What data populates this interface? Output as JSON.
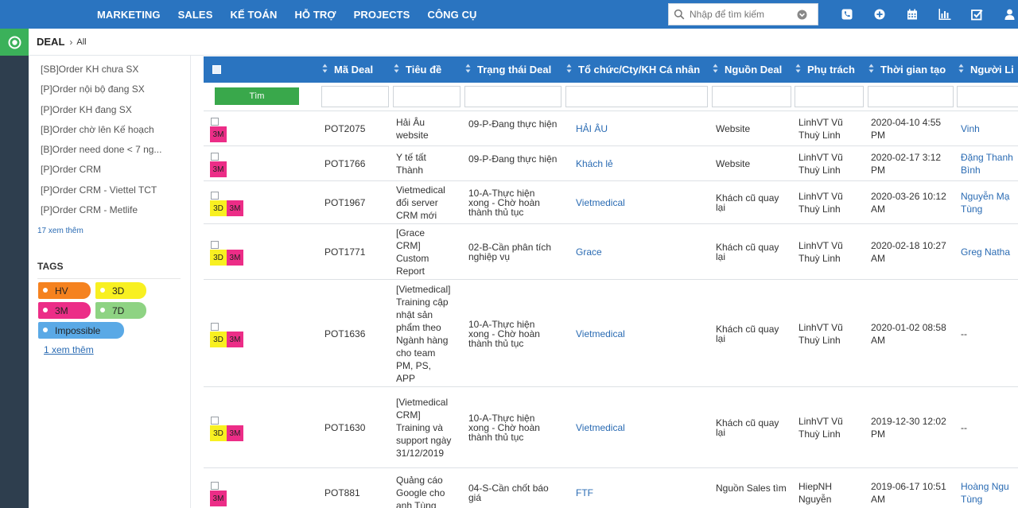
{
  "topnav": {
    "items": [
      "MARKETING",
      "SALES",
      "KẾ TOÁN",
      "HỖ TRỢ",
      "PROJECTS",
      "CÔNG CỤ"
    ]
  },
  "search": {
    "placeholder": "Nhập để tìm kiếm"
  },
  "toolbar": {
    "icons": [
      "phone-icon",
      "plus-circle-icon",
      "calendar-icon",
      "bar-chart-icon",
      "check-square-icon",
      "user-icon"
    ]
  },
  "breadcrumb": {
    "main": "DEAL",
    "sub": "All"
  },
  "filters": {
    "items": [
      "[SB]Order KH chưa SX",
      "[P]Order nội bộ đang SX",
      "[P]Order KH đang SX",
      "[B]Order chờ lên Kế hoạch",
      "[B]Order need done < 7 ng...",
      "[P]Order CRM",
      "[P]Order CRM - Viettel TCT",
      "[P]Order CRM - Metlife"
    ],
    "more": "17 xem thêm"
  },
  "tags": {
    "title": "TAGS",
    "items": [
      {
        "label": "HV",
        "color": "#f5821f"
      },
      {
        "label": "3D",
        "color": "#f8f021"
      },
      {
        "label": "3M",
        "color": "#ec2d87"
      },
      {
        "label": "7D",
        "color": "#8ed383"
      },
      {
        "label": "Impossible",
        "color": "#5aa9e6"
      }
    ],
    "more": "1  xem thêm"
  },
  "table": {
    "find_label": "Tìm",
    "headers": [
      "Mã Deal",
      "Tiêu đề",
      "Trạng thái Deal",
      "Tổ chức/Cty/KH Cá nhân",
      "Nguồn Deal",
      "Phụ trách",
      "Thời gian tạo",
      "Người Li"
    ],
    "rows": [
      {
        "badges": [
          "3M"
        ],
        "code": "POT2075",
        "title": "Hải Âu website",
        "status": "09-P-Đang thực hiện",
        "org": "HẢI ÂU",
        "source": "Website",
        "owner": "LinhVT Vũ Thuỳ Linh",
        "created": "2020-04-10 4:55 PM",
        "contact": "Vinh"
      },
      {
        "badges": [
          "3M"
        ],
        "code": "POT1766",
        "title": "Y tế tất Thành",
        "status": "09-P-Đang thực hiện",
        "org": "Khách lẻ",
        "source": "Website",
        "owner": "LinhVT Vũ Thuỳ Linh",
        "created": "2020-02-17 3:12 PM",
        "contact": "Đặng Thanh Bình"
      },
      {
        "badges": [
          "3D",
          "3M"
        ],
        "code": "POT1967",
        "title": "Vietmedical đổi server CRM mới",
        "status": "10-A-Thực hiện xong - Chờ hoàn thành thủ tục",
        "org": "Vietmedical",
        "source": "Khách cũ quay lại",
        "owner": "LinhVT Vũ Thuỳ Linh",
        "created": "2020-03-26 10:12 AM",
        "contact": "Nguyễn Mạ Tùng"
      },
      {
        "badges": [
          "3D",
          "3M"
        ],
        "code": "POT1771",
        "title": "[Grace CRM] Custom Report",
        "status": "02-B-Cần phân tích nghiệp vụ",
        "org": "Grace",
        "source": "Khách cũ quay lại",
        "owner": "LinhVT Vũ Thuỳ Linh",
        "created": "2020-02-18 10:27 AM",
        "contact": "Greg Natha"
      },
      {
        "badges": [
          "3D",
          "3M"
        ],
        "code": "POT1636",
        "title": "[Vietmedical] Training cập nhật sản phẩm theo Ngành hàng cho team PM, PS, APP",
        "status": "10-A-Thực hiện xong - Chờ hoàn thành thủ tục",
        "org": "Vietmedical",
        "source": "Khách cũ quay lại",
        "owner": "LinhVT Vũ Thuỳ Linh",
        "created": "2020-01-02 08:58 AM",
        "contact": "--"
      },
      {
        "badges": [
          "3D",
          "3M"
        ],
        "code": "POT1630",
        "title": "[Vietmedical CRM] Training và support ngày 31/12/2019",
        "status": "10-A-Thực hiện xong - Chờ hoàn thành thủ tục",
        "org": "Vietmedical",
        "source": "Khách cũ quay lại",
        "owner": "LinhVT Vũ Thuỳ Linh",
        "created": "2019-12-30 12:02 PM",
        "contact": "--"
      },
      {
        "badges": [
          "3M"
        ],
        "code": "POT881",
        "title": "Quảng cáo Google cho anh Tùng",
        "status": "04-S-Cần chốt báo giá",
        "org": "FTF",
        "source": "Nguồn Sales tìm",
        "owner": "HiepNH Nguyễn Hoàng Hiệp",
        "created": "2019-06-17 10:51 AM",
        "contact": "Hoàng Ngu Tùng"
      }
    ]
  }
}
